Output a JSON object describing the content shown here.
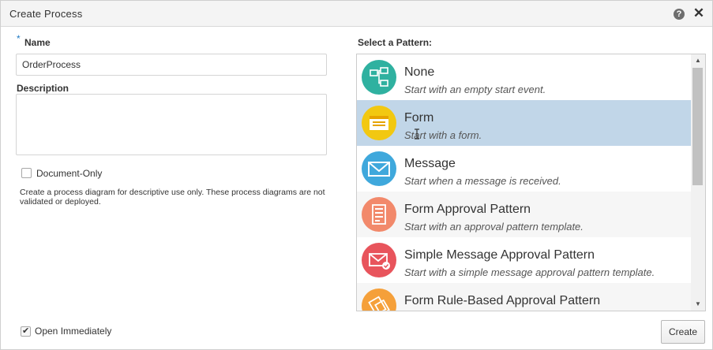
{
  "dialog": {
    "title": "Create Process",
    "help_icon": "help-icon",
    "close_icon": "close-icon"
  },
  "form": {
    "required_marker": "*",
    "name_label": "Name",
    "name_value": "OrderProcess",
    "description_label": "Description",
    "description_value": "",
    "document_only_label": "Document-Only",
    "document_only_checked": false,
    "document_only_help": "Create a process diagram for descriptive use only. These process diagrams are not validated or deployed.",
    "open_immediately_label": "Open Immediately",
    "open_immediately_checked": true
  },
  "patterns": {
    "label": "Select a Pattern:",
    "selected": "Form",
    "items": [
      {
        "title": "None",
        "subtitle": "Start with an empty start event.",
        "icon": "process-flow-icon",
        "color": "#2fb1a0"
      },
      {
        "title": "Form",
        "subtitle": "Start with a form.",
        "icon": "form-icon",
        "color": "#f2c811"
      },
      {
        "title": "Message",
        "subtitle": "Start when a message is received.",
        "icon": "envelope-icon",
        "color": "#3fa8dc"
      },
      {
        "title": "Form Approval Pattern",
        "subtitle": "Start with an approval pattern template.",
        "icon": "form-approval-icon",
        "color": "#f2896b"
      },
      {
        "title": "Simple Message Approval Pattern",
        "subtitle": "Start with a simple message approval pattern template.",
        "icon": "message-approval-icon",
        "color": "#e8545c"
      },
      {
        "title": "Form Rule-Based Approval Pattern",
        "subtitle": "",
        "icon": "form-rule-icon",
        "color": "#f5a03a"
      }
    ]
  },
  "footer": {
    "create_label": "Create"
  },
  "colors": {
    "selected_row": "#c1d6e8",
    "alt_row": "#f6f6f6",
    "required_star": "#1f79c4"
  }
}
